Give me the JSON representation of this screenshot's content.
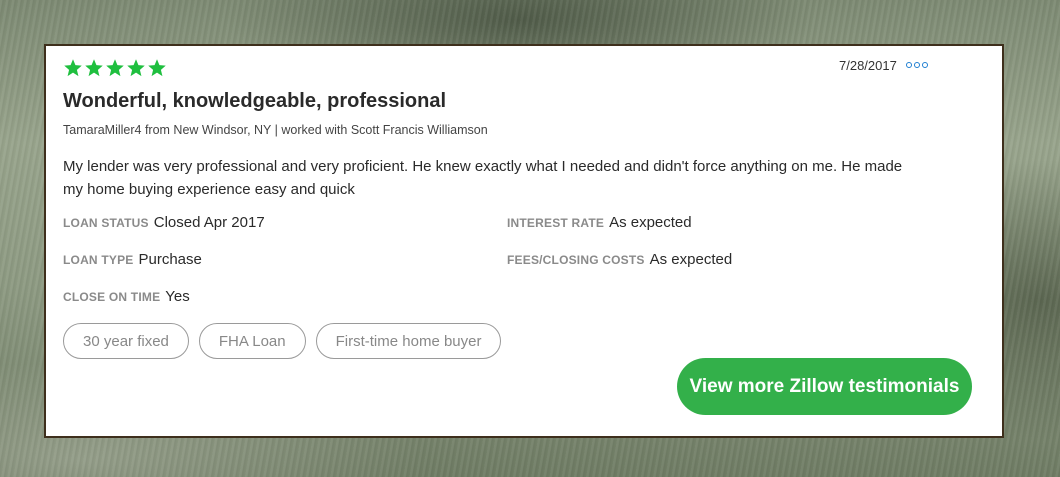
{
  "review": {
    "rating": 5,
    "rating_max": 5,
    "date": "7/28/2017",
    "title": "Wonderful, knowledgeable, professional",
    "meta": "TamaraMiller4 from New Windsor, NY | worked with Scott Francis Williamson",
    "body": "My lender was very professional and very proficient. He knew exactly what I needed and didn't force anything on me. He made my home buying experience easy and quick",
    "fields": {
      "loan_status": {
        "label": "LOAN STATUS",
        "value": "Closed Apr 2017"
      },
      "interest_rate": {
        "label": "INTEREST RATE",
        "value": "As expected"
      },
      "loan_type": {
        "label": "LOAN TYPE",
        "value": "Purchase"
      },
      "fees": {
        "label": "FEES/CLOSING COSTS",
        "value": "As expected"
      },
      "close_on_time": {
        "label": "CLOSE ON TIME",
        "value": "Yes"
      }
    },
    "tags": [
      "30 year fixed",
      "FHA Loan",
      "First-time home buyer"
    ]
  },
  "cta": {
    "label": "View more Zillow testimonials"
  },
  "icons": {
    "star": "star-icon",
    "more": "more-options-icon"
  },
  "colors": {
    "accent": "#33b04a",
    "star": "#1fbf3f",
    "link": "#1f7fd1",
    "border": "#3e2f1c"
  }
}
